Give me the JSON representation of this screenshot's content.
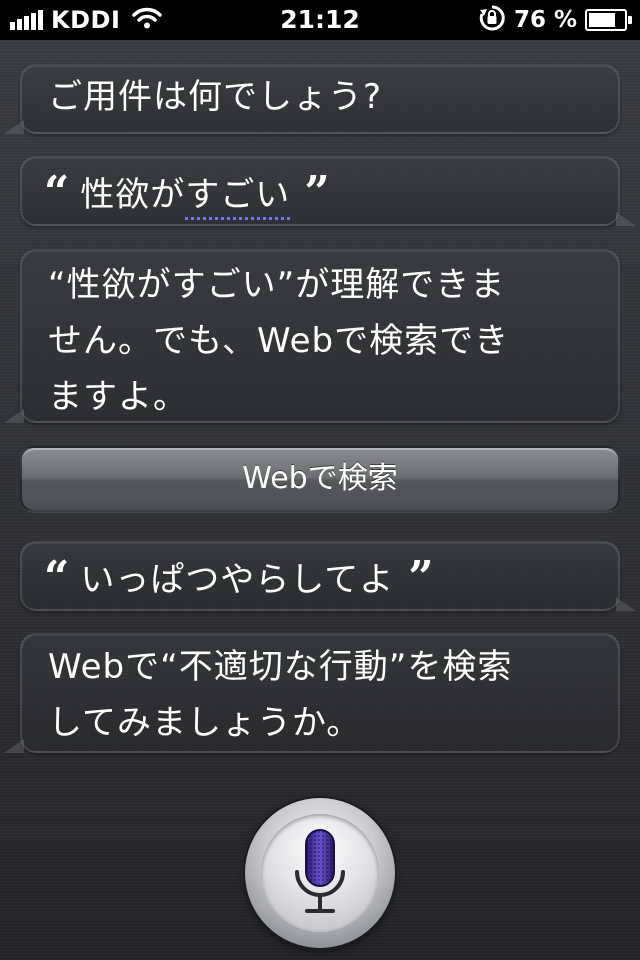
{
  "status_bar": {
    "carrier": "KDDI",
    "time": "21:12",
    "battery_percent_label": "76 %",
    "battery_level": 0.76,
    "signal_bars": 5,
    "icons": [
      "signal-icon",
      "wifi-icon",
      "rotation-lock-icon",
      "battery-icon"
    ]
  },
  "conversation": {
    "siri_prompt": "ご用件は何でしょう?",
    "user_query_1": "性欲がすごい",
    "siri_reply_1": {
      "line1": "“性欲がすごい”が理解できま",
      "line2": "せん。でも、Webで検索でき",
      "line3": "ますよ。"
    },
    "web_search_button": "Webで検索",
    "user_query_2": "いっぱつやらしてよ",
    "siri_reply_2": {
      "line1": "Webで“不適切な行動”を検索",
      "line2": "してみましょうか。"
    }
  },
  "mic": {
    "icon": "microphone-icon",
    "accent": "#5a3fb8"
  },
  "colors": {
    "background": "#33353c",
    "dotted_underline": "#6b78e6"
  }
}
